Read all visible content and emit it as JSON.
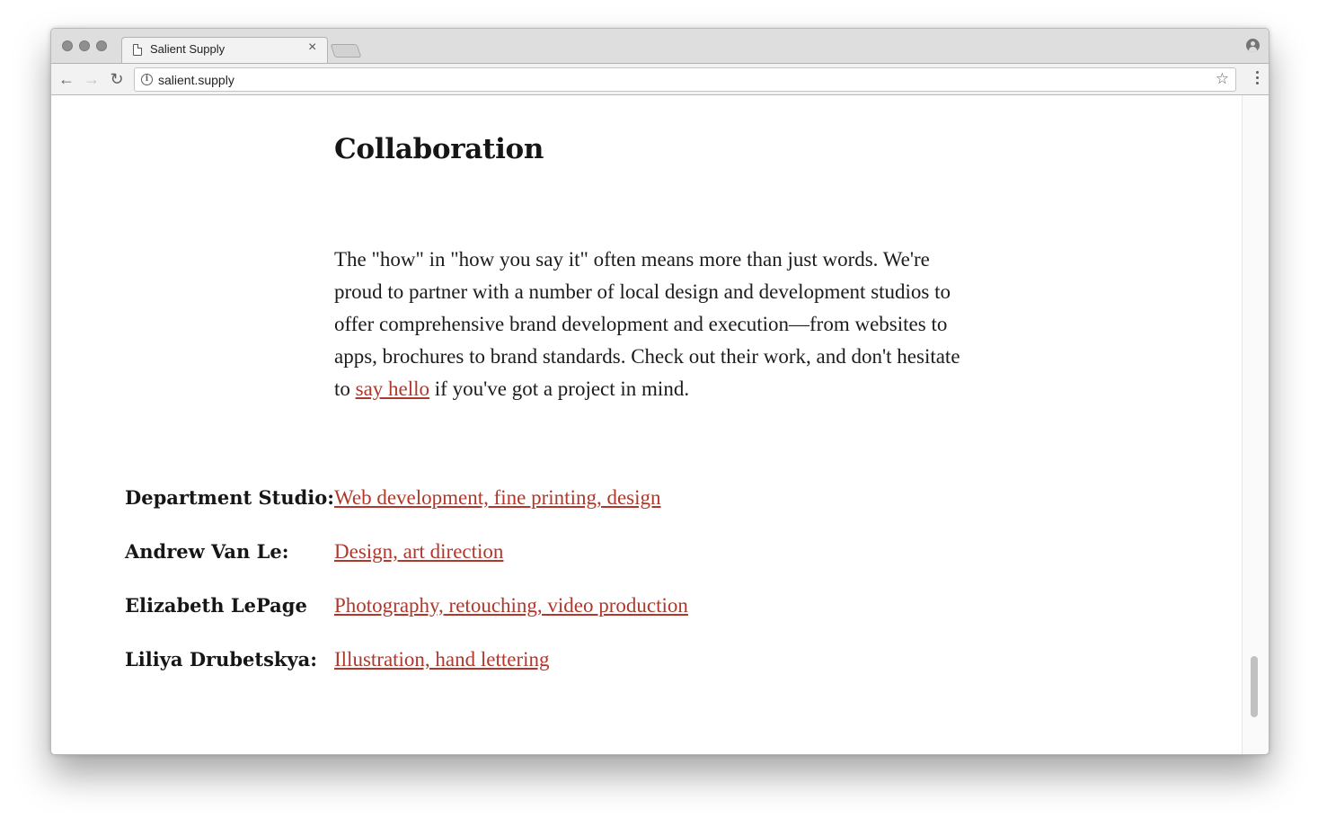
{
  "browser": {
    "tab_title": "Salient Supply",
    "tab_close": "×",
    "url": "salient.supply",
    "back": "←",
    "forward": "→",
    "reload": "↻",
    "star": "☆",
    "info": "i"
  },
  "page": {
    "heading": "Collaboration",
    "intro_before": "The \"how\" in \"how you say it\" often means more than just words. We're proud to partner with a number of local design and development studios to offer comprehensive brand development and execution—from websites to apps, brochures to brand standards. Check out their work, and don't hesitate to ",
    "intro_link": "say hello",
    "intro_after": " if you've got a project in mind.",
    "partners": [
      {
        "name": "Department Studio:",
        "services": "Web development, fine printing, design"
      },
      {
        "name": "Andrew Van Le:",
        "services": "Design, art direction"
      },
      {
        "name": "Elizabeth LePage",
        "services": "Photography, retouching, video production"
      },
      {
        "name": "Liliya Drubetskya:",
        "services": "Illustration, hand lettering"
      }
    ]
  },
  "colors": {
    "link": "#b0372b",
    "text": "#1c1c1c"
  }
}
